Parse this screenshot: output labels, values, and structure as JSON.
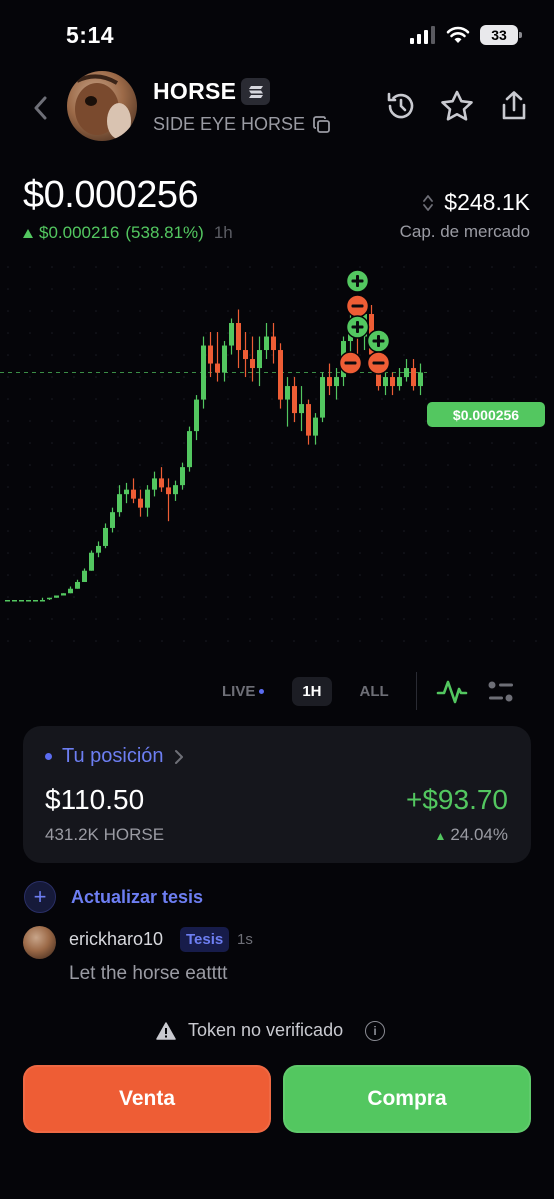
{
  "status_bar": {
    "time": "5:14",
    "battery": "33"
  },
  "header": {
    "token_symbol": "HORSE",
    "token_name": "SIDE EYE HORSE",
    "icons": [
      "back-chevron-icon",
      "solana-icon",
      "copy-icon",
      "history-icon",
      "star-icon",
      "share-icon"
    ]
  },
  "price": {
    "current": "$0.000256",
    "change_abs": "$0.000216",
    "change_pct": "(538.81%)",
    "period": "1h",
    "market_cap": "$248.1K",
    "market_cap_label": "Cap. de mercado"
  },
  "chart": {
    "price_tag": "$0.000256",
    "up_color": "#53c760",
    "down_color": "#ee5d35"
  },
  "chart_data": {
    "type": "candlestick",
    "series": [
      {
        "candles": [
          [
            1,
            1,
            1,
            1
          ],
          [
            1,
            1,
            1,
            1
          ],
          [
            1,
            1,
            1,
            1
          ],
          [
            1,
            1,
            1,
            1
          ],
          [
            1,
            1,
            1,
            1
          ],
          [
            1,
            2,
            1,
            1
          ],
          [
            2,
            2,
            1,
            2
          ],
          [
            2,
            3,
            2,
            3
          ],
          [
            3,
            4,
            3,
            4
          ],
          [
            4,
            7,
            4,
            6
          ],
          [
            6,
            10,
            6,
            9
          ],
          [
            9,
            15,
            9,
            14
          ],
          [
            14,
            23,
            14,
            22
          ],
          [
            22,
            27,
            20,
            25
          ],
          [
            25,
            35,
            24,
            33
          ],
          [
            33,
            42,
            31,
            40
          ],
          [
            40,
            52,
            38,
            48
          ],
          [
            48,
            53,
            44,
            50
          ],
          [
            50,
            55,
            44,
            46
          ],
          [
            46,
            50,
            38,
            42
          ],
          [
            42,
            52,
            38,
            50
          ],
          [
            50,
            58,
            47,
            55
          ],
          [
            55,
            60,
            49,
            51
          ],
          [
            51,
            55,
            36,
            48
          ],
          [
            48,
            54,
            45,
            52
          ],
          [
            52,
            62,
            50,
            60
          ],
          [
            60,
            78,
            58,
            76
          ],
          [
            76,
            92,
            72,
            90
          ],
          [
            90,
            118,
            86,
            114
          ],
          [
            114,
            120,
            100,
            106
          ],
          [
            106,
            120,
            98,
            102
          ],
          [
            102,
            116,
            98,
            114
          ],
          [
            114,
            126,
            110,
            124
          ],
          [
            124,
            130,
            104,
            112
          ],
          [
            112,
            120,
            100,
            108
          ],
          [
            108,
            118,
            98,
            104
          ],
          [
            104,
            118,
            96,
            112
          ],
          [
            112,
            124,
            108,
            118
          ],
          [
            118,
            124,
            106,
            112
          ],
          [
            112,
            115,
            86,
            90
          ],
          [
            90,
            100,
            78,
            96
          ],
          [
            96,
            100,
            80,
            84
          ],
          [
            84,
            96,
            76,
            88
          ],
          [
            88,
            90,
            70,
            74
          ],
          [
            74,
            84,
            70,
            82
          ],
          [
            82,
            102,
            80,
            100
          ],
          [
            100,
            106,
            92,
            96
          ],
          [
            96,
            104,
            90,
            100
          ],
          [
            100,
            118,
            96,
            116
          ],
          [
            116,
            130,
            108,
            124
          ],
          [
            124,
            132,
            110,
            118
          ],
          [
            118,
            130,
            112,
            128
          ],
          [
            128,
            132,
            108,
            110
          ],
          [
            110,
            112,
            94,
            96
          ],
          [
            96,
            102,
            92,
            100
          ],
          [
            100,
            102,
            92,
            96
          ],
          [
            96,
            104,
            94,
            100
          ],
          [
            100,
            108,
            98,
            104
          ],
          [
            104,
            108,
            94,
            96
          ],
          [
            96,
            106,
            92,
            102
          ]
        ]
      }
    ]
  },
  "range": {
    "live": "LIVE",
    "one_hour": "1H",
    "all": "ALL"
  },
  "position": {
    "title": "Tu posición",
    "value": "$110.50",
    "quantity": "431.2K HORSE",
    "pnl": "+$93.70",
    "pnl_pct": "24.04%"
  },
  "thesis": {
    "action": "Actualizar tesis",
    "user": "erickharo10",
    "badge": "Tesis",
    "time": "1s",
    "comment": "Let the horse eatttt"
  },
  "warning": "Token no verificado",
  "buttons": {
    "sell": "Venta",
    "buy": "Compra"
  }
}
